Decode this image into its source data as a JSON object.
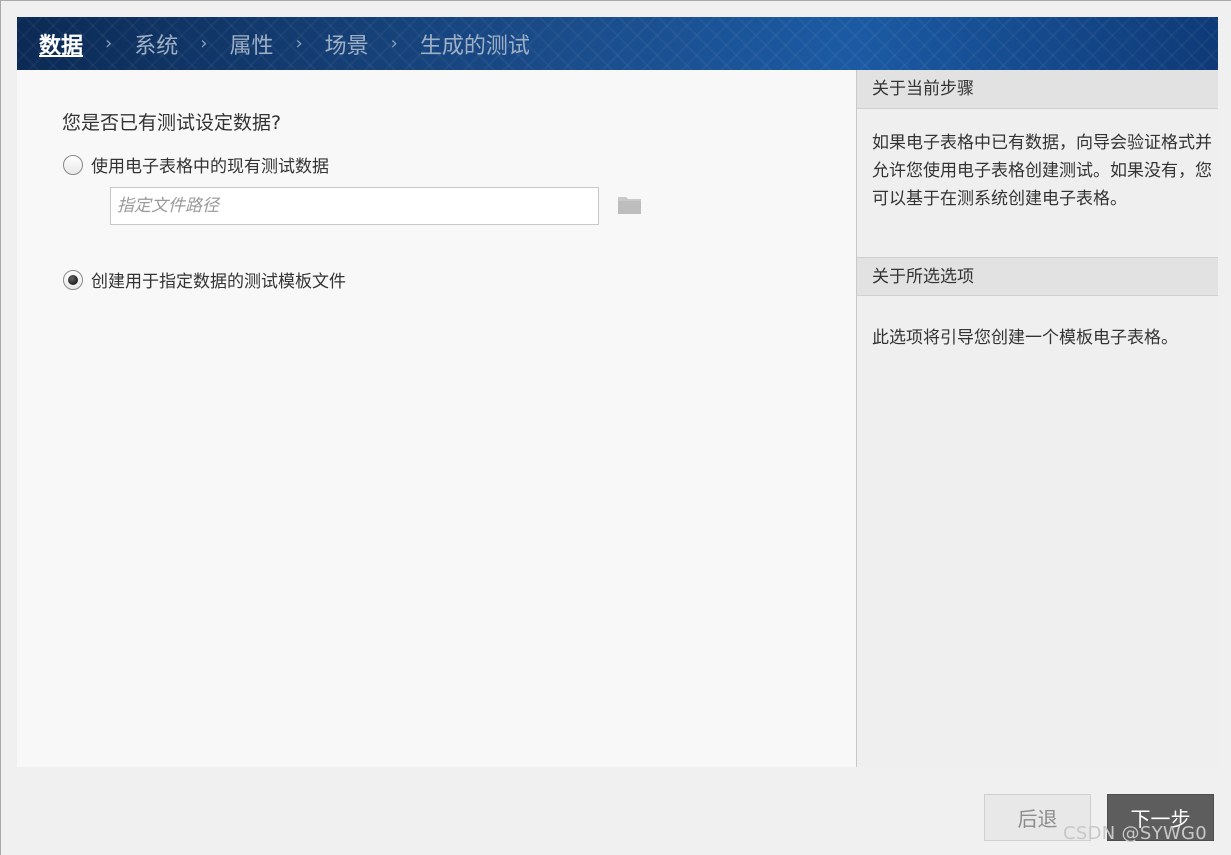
{
  "wizard": {
    "steps": [
      "数据",
      "系统",
      "属性",
      "场景",
      "生成的测试"
    ],
    "step_separator": "›",
    "active_step": 0
  },
  "main": {
    "question": "您是否已有测试设定数据?",
    "options": [
      {
        "label": "使用电子表格中的现有测试数据",
        "checked": false
      },
      {
        "label": "创建用于指定数据的测试模板文件",
        "checked": true
      }
    ],
    "file_path": {
      "value": "",
      "placeholder": "指定文件路径"
    },
    "browse_icon": "folder-icon"
  },
  "sidebar": {
    "step_heading": "关于当前步骤",
    "step_text": "如果电子表格中已有数据，向导会验证格式并允许您使用电子表格创建测试。如果没有，您可以基于在测系统创建电子表格。",
    "option_heading": "关于所选选项",
    "option_text": "此选项将引导您创建一个模板电子表格。"
  },
  "footer": {
    "back_label": "后退",
    "next_label": "下一步",
    "watermark": "CSDN @SYWG0"
  },
  "colors": {
    "header_dark": "#0b2a55",
    "header_mid": "#1b5aa3",
    "next_button": "#5d5d5d"
  }
}
